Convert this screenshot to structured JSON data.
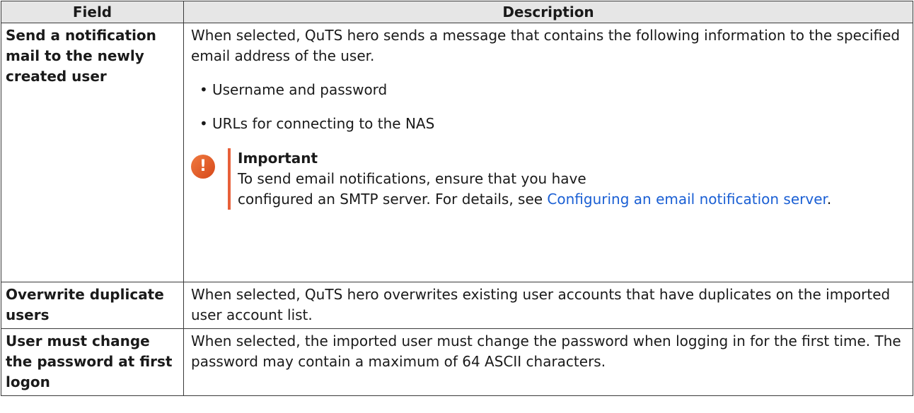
{
  "table": {
    "header": {
      "field": "Field",
      "description": "Description"
    },
    "rows": [
      {
        "field": "Send a notification mail to the newly created user",
        "intro": "When selected, QuTS hero sends a message that contains the following information to the specified email address of the user.",
        "bullets": [
          "Username and password",
          "URLs for connecting to the NAS"
        ],
        "note": {
          "title": "Important",
          "line1": "To send email notifications, ensure that you have",
          "line2": "configured an SMTP server. For details, see ",
          "link": "Configuring an email notification server",
          "end": "."
        }
      },
      {
        "field": "Overwrite duplicate users",
        "description": "When selected, QuTS hero overwrites existing user accounts that have duplicates on the imported user account list."
      },
      {
        "field": "User must change the password at first logon",
        "description": "When selected, the imported user must change the password when logging in for the first time. The password may contain a maximum of 64 ASCII characters."
      }
    ]
  },
  "colors": {
    "header_bg": "#e6e6e6",
    "note_accent": "#e8603a",
    "link": "#1a5fd4"
  },
  "icons": {
    "note": "exclamation-icon"
  }
}
